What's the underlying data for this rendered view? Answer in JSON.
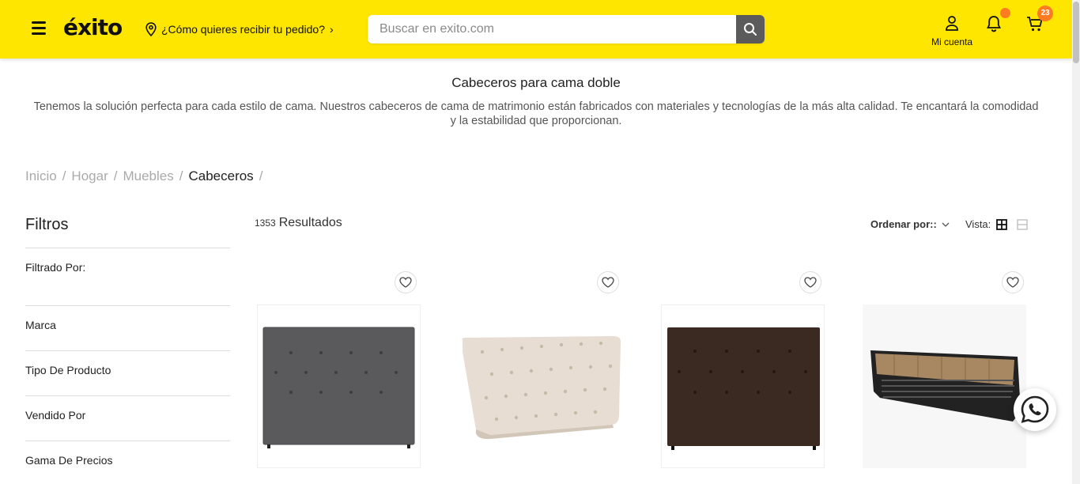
{
  "header": {
    "logo_text": "éxito",
    "delivery_prompt": "¿Cómo quieres recibir tu pedido?",
    "search_placeholder": "Buscar en exito.com",
    "account_label": "Mi cuenta",
    "cart_count": "23",
    "brand_color": "#FFE600",
    "badge_color": "#FF7B22"
  },
  "category": {
    "title": "Cabeceros para cama doble",
    "description": "Tenemos la solución perfecta para cada estilo de cama. Nuestros cabeceros de cama de matrimonio están fabricados con materiales y tecnologías de la más alta calidad. Te encantará la comodidad y la estabilidad que proporcionan."
  },
  "breadcrumb": {
    "items": [
      "Inicio",
      "Hogar",
      "Muebles",
      "Cabeceros"
    ],
    "separator": "/"
  },
  "filters": {
    "title": "Filtros",
    "applied_label": "Filtrado Por:",
    "groups": [
      "Marca",
      "Tipo De Producto",
      "Vendido Por",
      "Gama De Precios"
    ]
  },
  "results": {
    "count": "1353",
    "label": "Resultados"
  },
  "toolbar": {
    "sort_label": "Ordenar por::",
    "view_label": "Vista:"
  },
  "products": [
    {
      "image": "gray-tufted-headboard",
      "color": "#5a5a5c"
    },
    {
      "image": "cream-tufted-headboard",
      "color": "#e8ddd2"
    },
    {
      "image": "brown-tufted-headboard",
      "color": "#3a2a22"
    },
    {
      "image": "wood-metal-headboard",
      "color": "#a88763"
    }
  ]
}
